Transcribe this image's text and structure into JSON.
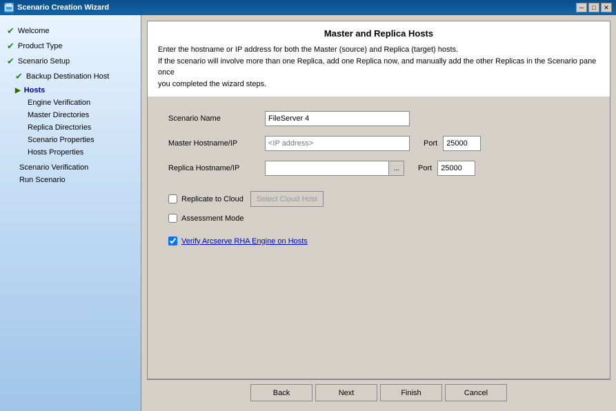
{
  "window": {
    "title": "Scenario Creation Wizard",
    "icon": "W"
  },
  "titlebar_buttons": {
    "minimize": "─",
    "restore": "□",
    "close": "✕"
  },
  "sidebar": {
    "items": [
      {
        "id": "welcome",
        "label": "Welcome",
        "indent": 0,
        "status": "checked",
        "active": false
      },
      {
        "id": "product-type",
        "label": "Product Type",
        "indent": 0,
        "status": "checked",
        "active": false
      },
      {
        "id": "scenario-setup",
        "label": "Scenario Setup",
        "indent": 0,
        "status": "checked",
        "active": false
      },
      {
        "id": "backup-destination",
        "label": "Backup Destination Host",
        "indent": 1,
        "status": "checked",
        "active": false
      },
      {
        "id": "hosts",
        "label": "Hosts",
        "indent": 1,
        "status": "arrow",
        "active": true
      },
      {
        "id": "engine-verification",
        "label": "Engine Verification",
        "indent": 1,
        "status": "none",
        "active": false
      },
      {
        "id": "master-directories",
        "label": "Master Directories",
        "indent": 1,
        "status": "none",
        "active": false
      },
      {
        "id": "replica-directories",
        "label": "Replica Directories",
        "indent": 1,
        "status": "none",
        "active": false
      },
      {
        "id": "scenario-properties",
        "label": "Scenario Properties",
        "indent": 1,
        "status": "none",
        "active": false
      },
      {
        "id": "hosts-properties",
        "label": "Hosts Properties",
        "indent": 1,
        "status": "none",
        "active": false
      },
      {
        "id": "scenario-verification",
        "label": "Scenario Verification",
        "indent": 0,
        "status": "none",
        "active": false
      },
      {
        "id": "run-scenario",
        "label": "Run Scenario",
        "indent": 0,
        "status": "none",
        "active": false
      }
    ]
  },
  "panel": {
    "title": "Master and Replica Hosts",
    "description_line1": "Enter the hostname or IP address for both the Master (source) and Replica (target) hosts.",
    "description_line2": "If the scenario will involve more than one Replica, add one Replica now, and manually add the other Replicas in the Scenario pane once",
    "description_line3": "you completed the wizard steps."
  },
  "form": {
    "scenario_name_label": "Scenario Name",
    "scenario_name_value": "FileServer 4",
    "master_host_label": "Master Hostname/IP",
    "master_host_placeholder": "<IP address>",
    "master_port_label": "Port",
    "master_port_value": "25000",
    "replica_host_label": "Replica Hostname/IP",
    "replica_host_value": "",
    "replica_port_label": "Port",
    "replica_port_value": "25000",
    "replicate_cloud_label": "Replicate to Cloud",
    "select_cloud_host_label": "Select Cloud Host",
    "assessment_mode_label": "Assessment Mode",
    "verify_engine_label": "Verify Arcserve RHA Engine on Hosts",
    "verify_engine_checked": true
  },
  "buttons": {
    "back": "Back",
    "next": "Next",
    "finish": "Finish",
    "cancel": "Cancel",
    "browse": "...",
    "select_cloud": "Select Cloud Host"
  }
}
